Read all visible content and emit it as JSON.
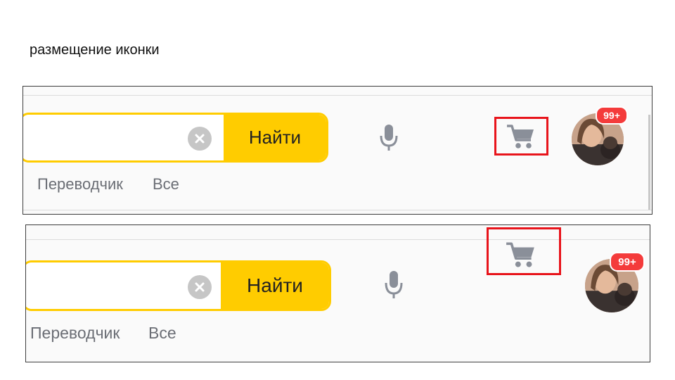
{
  "slide": {
    "title": "размещение иконки"
  },
  "search": {
    "button_label": "Найти"
  },
  "services": {
    "translator": "Переводчик",
    "all": "Все"
  },
  "notifications": {
    "badge": "99+"
  },
  "icons": {
    "clear": "clear-icon",
    "microphone": "microphone-icon",
    "cart": "cart-icon",
    "avatar": "avatar"
  },
  "colors": {
    "accent": "#ffcc00",
    "highlight": "#e8141b",
    "badge": "#f43b3b",
    "icon_gray": "#8a8f99",
    "link_gray": "#6b6e75"
  }
}
